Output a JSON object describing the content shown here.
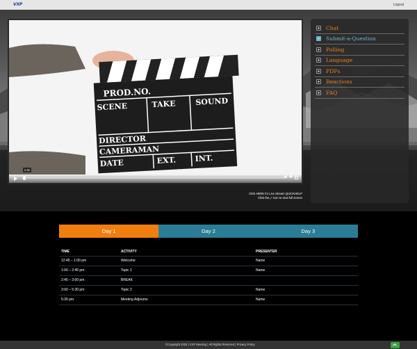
{
  "header": {
    "logo_text": "VXP",
    "logout_label": "Logout"
  },
  "video": {
    "time_tooltip": "0:38"
  },
  "help": {
    "line1": "Click HERE for Live Stream QUICKHELP",
    "line2": "Click the ⤢ icon to view full screen"
  },
  "menu": {
    "items": [
      {
        "label": "Chat",
        "active": false
      },
      {
        "label": "Submit-a-Question",
        "active": true
      },
      {
        "label": "Polling",
        "active": false
      },
      {
        "label": "Language",
        "active": false
      },
      {
        "label": "PDFs",
        "active": false
      },
      {
        "label": "Reactions",
        "active": false
      },
      {
        "label": "FAQ",
        "active": false
      }
    ]
  },
  "tabs": [
    {
      "label": "Day 1"
    },
    {
      "label": "Day 2"
    },
    {
      "label": "Day 3"
    }
  ],
  "schedule": {
    "headers": [
      "TIME",
      "ACTIVITY",
      "PRESENTER"
    ],
    "rows": [
      {
        "time": "12:45 – 1:00 pm",
        "activity": "Welcome",
        "presenter": "Name"
      },
      {
        "time": "1:00 – 2:45 pm",
        "activity": "Topic 1",
        "presenter": "Name"
      },
      {
        "time": "2:45 – 3:00 pm",
        "activity": "BREAK",
        "presenter": ""
      },
      {
        "time": "3:00 – 5:30 pm",
        "activity": "Topic 2",
        "presenter": "Name"
      },
      {
        "time": "5:30 pm",
        "activity": "Meeting Adjourns",
        "presenter": "Name"
      }
    ]
  },
  "footer": {
    "text": "©Copyright 2025 | VXP Meeting | All Rights Reserved | Privacy Policy"
  },
  "colors": {
    "accent_orange": "#f07f0f",
    "tab_teal": "#2b7d95",
    "menu_active": "#6fb9d1"
  }
}
